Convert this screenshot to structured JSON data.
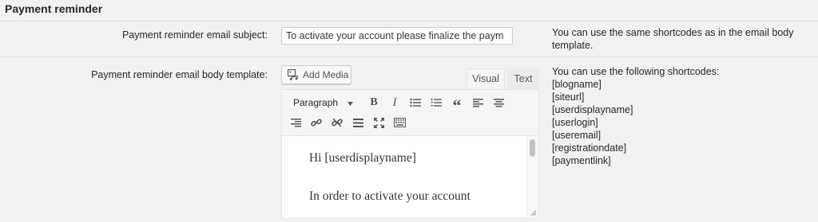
{
  "section": {
    "title": "Payment reminder"
  },
  "subject": {
    "label": "Payment reminder email subject:",
    "value": "To activate your account please finalize the paym",
    "hint": "You can use the same shortcodes as in the email body template."
  },
  "body": {
    "label": "Payment reminder email body template:",
    "add_media_label": "Add Media",
    "tabs": {
      "visual": "Visual",
      "text": "Text",
      "active": "Visual"
    },
    "format_value": "Paragraph",
    "content": [
      "Hi [userdisplayname]",
      "In order to activate your account"
    ],
    "hint_heading": "You can use the following shortcodes:",
    "shortcodes": [
      "[blogname]",
      "[siteurl]",
      "[userdisplayname]",
      "[userlogin]",
      "[useremail]",
      "[registrationdate]",
      "[paymentlink]"
    ]
  },
  "toolbar": {
    "row1": [
      "bold-icon",
      "italic-icon",
      "bullet-list-icon",
      "numbered-list-icon",
      "blockquote-icon",
      "align-left-icon",
      "align-center-icon"
    ],
    "row2": [
      "align-right-icon",
      "link-icon",
      "unlink-icon",
      "read-more-icon",
      "fullscreen-icon",
      "toolbar-toggle-icon"
    ],
    "bold_glyph": "B",
    "italic_glyph": "I",
    "quote_glyph": "“"
  }
}
